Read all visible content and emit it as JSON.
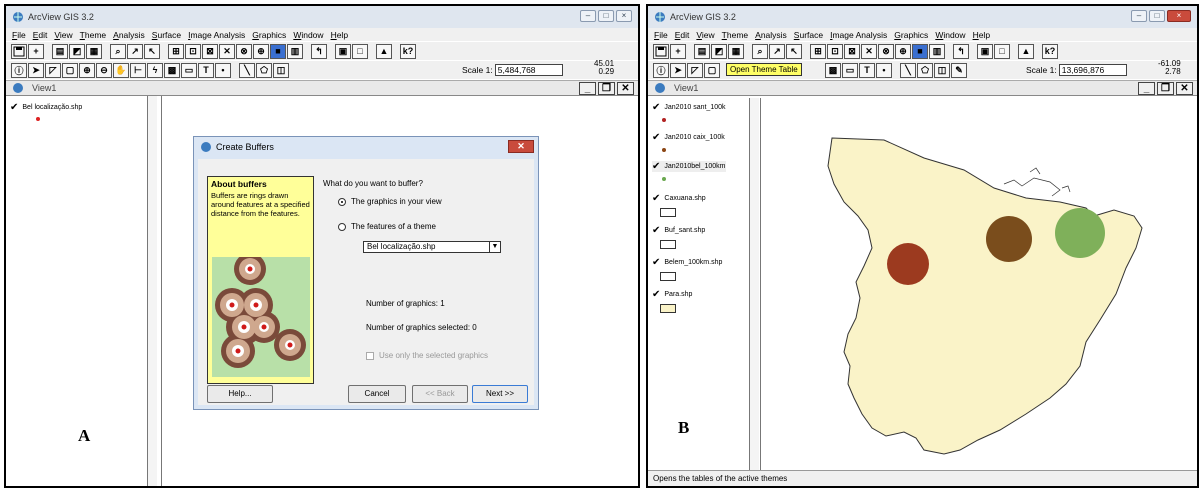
{
  "panel_a": {
    "title": "ArcView GIS 3.2",
    "menu": [
      "File",
      "Edit",
      "View",
      "Theme",
      "Analysis",
      "Surface",
      "Image Analysis",
      "Graphics",
      "Window",
      "Help"
    ],
    "scale_label": "Scale 1:",
    "scale_value": "5,484,768",
    "coord_x": "45.01",
    "coord_y": "0.29",
    "view_title": "View1",
    "theme": "Bel localização.shp",
    "label": "A",
    "dialog": {
      "title": "Create Buffers",
      "about_title": "About buffers",
      "about_text": "Buffers are rings drawn around features at a specified distance from the features.",
      "question": "What do you want to buffer?",
      "opt_graphics": "The graphics in your view",
      "opt_features": "The features of a theme",
      "theme_select": "Bel localização.shp",
      "num_graphics": "Number of graphics:  1",
      "num_selected": "Number of graphics selected:  0",
      "use_selected": "Use only the selected graphics",
      "help": "Help...",
      "cancel": "Cancel",
      "back": "<< Back",
      "next": "Next >>"
    }
  },
  "panel_b": {
    "title": "ArcView GIS 3.2",
    "menu": [
      "File",
      "Edit",
      "View",
      "Theme",
      "Analysis",
      "Surface",
      "Image Analysis",
      "Graphics",
      "Window",
      "Help"
    ],
    "scale_label": "Scale 1:",
    "scale_value": "13,696,876",
    "coord_x": "-61.09",
    "coord_y": "2.78",
    "view_title": "View1",
    "tooltip": "Open Theme Table",
    "status": "Opens the tables of the active themes",
    "label": "B",
    "themes": [
      {
        "name": "Jan2010 sant_100k",
        "dot": "#b22222"
      },
      {
        "name": "Jan2010 caix_100k",
        "dot": "#8b4513"
      },
      {
        "name": "Jan2010bel_100km",
        "dot": "#6aa84f"
      },
      {
        "name": "Caxuana.shp",
        "dot": ""
      },
      {
        "name": "Buf_sant.shp",
        "dot": ""
      },
      {
        "name": "Belem_100km.shp",
        "dot": ""
      },
      {
        "name": "Para.shp",
        "dot": ""
      }
    ],
    "colors": {
      "state_fill": "#faf3c8",
      "buffer_sant": "#9c3a1f",
      "buffer_caix": "#7a4d1c",
      "buffer_bel": "#7fb05a"
    }
  }
}
